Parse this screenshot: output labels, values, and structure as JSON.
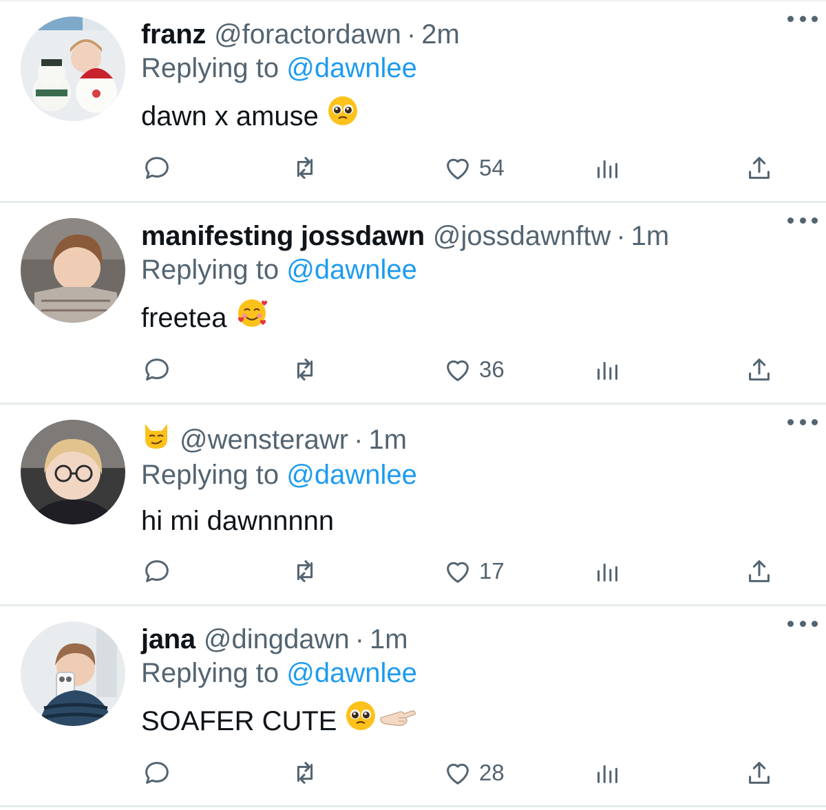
{
  "reply_prefix": "Replying to",
  "reply_target": "@dawnlee",
  "tweets": [
    {
      "name": "franz",
      "handle": "@foractordawn",
      "separator": "·",
      "time": "2m",
      "text": "dawn x amuse",
      "emoji": "pleading-face",
      "likes": "54",
      "avatar_bg": "#dfe6ec"
    },
    {
      "name": "manifesting jossdawn",
      "handle": "@jossdawnftw",
      "separator": "·",
      "time": "1m",
      "text": "freetea",
      "emoji": "smiling-face-with-hearts",
      "likes": "36",
      "avatar_bg": "#6f6a66"
    },
    {
      "name": "",
      "name_emoji": "smirking-cat",
      "handle": "@wensterawr",
      "separator": "·",
      "time": "1m",
      "text": "hi mi dawnnnnn",
      "emoji": "",
      "likes": "17",
      "avatar_bg": "#3a3a3a"
    },
    {
      "name": "jana",
      "handle": "@dingdawn",
      "separator": "·",
      "time": "1m",
      "text": "SOAFER CUTE",
      "emoji": "pleading-face-with-pointing-hand",
      "likes": "28",
      "avatar_bg": "#e9ecef"
    }
  ],
  "colors": {
    "link": "#1d9bf0",
    "secondary": "#536471",
    "text": "#0f1419",
    "divider": "#e7ebed"
  }
}
